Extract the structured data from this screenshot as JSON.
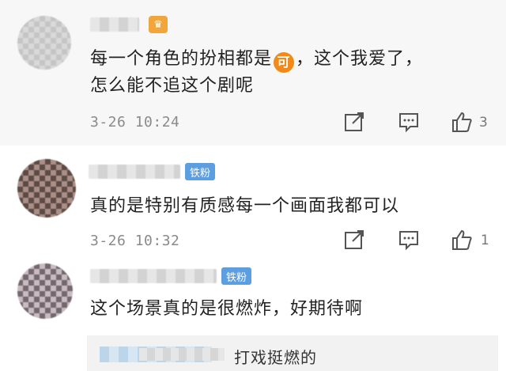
{
  "comments": [
    {
      "badge": "",
      "text_line1_a": "每一个角色的扮相都是",
      "emoji": "可",
      "text_line1_b": "，这个我爱了，",
      "text_line2": "怎么能不追这个剧呢",
      "date": "3-26",
      "time": "10:24",
      "likes": "3"
    },
    {
      "badge": "铁粉",
      "text": "真的是特别有质感每一个画面我都可以",
      "date": "3-26",
      "time": "10:32",
      "likes": "1"
    },
    {
      "badge": "铁粉",
      "text": "这个场景真的是很燃炸，好期待啊",
      "reply": {
        "text": "打戏挺燃的"
      }
    }
  ],
  "icons": {
    "share": "share-icon",
    "comment": "comment-icon",
    "like": "like-icon",
    "vip": "vip-crown-icon"
  },
  "colors": {
    "fan_badge": "#5d9ee0",
    "vip_badge": "#f0a63a",
    "meta_text": "#8a8a8a"
  }
}
